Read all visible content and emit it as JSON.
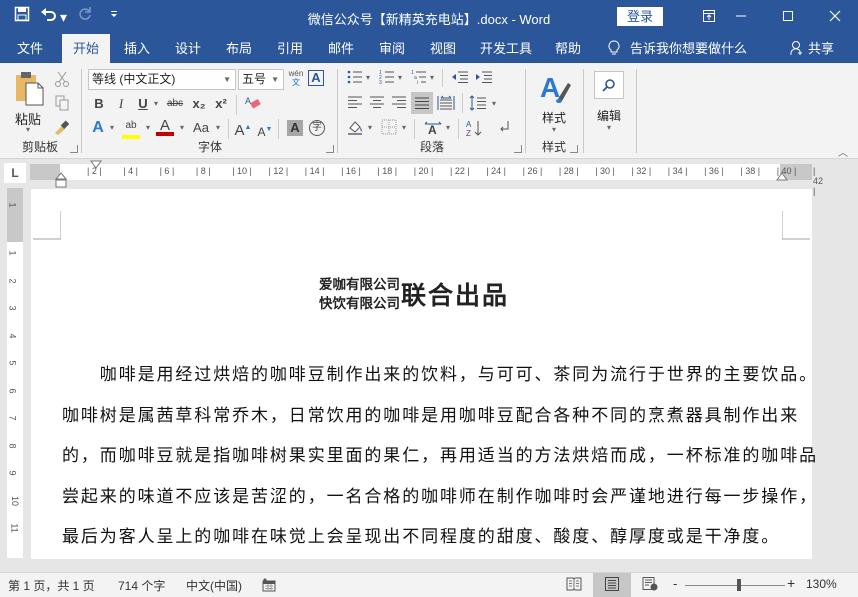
{
  "window": {
    "title": "微信公众号【新精英充电站】.docx  -  Word",
    "login_label": "登录",
    "controls": {
      "ribbon_display": "⊡",
      "minimize": "—",
      "maximize": "☐",
      "close": "✕"
    }
  },
  "qat": {
    "save_icon": "💾",
    "undo_icon": "↶",
    "undo_caret": "▾",
    "redo_icon": "↻",
    "customize_icon": "≡"
  },
  "tabs": [
    {
      "label": "文件"
    },
    {
      "label": "开始",
      "active": true
    },
    {
      "label": "插入"
    },
    {
      "label": "设计"
    },
    {
      "label": "布局"
    },
    {
      "label": "引用"
    },
    {
      "label": "邮件"
    },
    {
      "label": "审阅"
    },
    {
      "label": "视图"
    },
    {
      "label": "开发工具"
    },
    {
      "label": "帮助"
    }
  ],
  "tellme": {
    "icon": "💡",
    "label": "告诉我你想要做什么"
  },
  "share": {
    "icon": "👤",
    "label": "共享"
  },
  "ribbon": {
    "clipboard": {
      "label": "剪贴板",
      "paste_label": "粘贴"
    },
    "font": {
      "label": "字体",
      "font_name": "等线 (中文正文)",
      "font_size": "五号",
      "phonetic": "wén",
      "border_char": "A",
      "bold": "B",
      "italic": "I",
      "underline": "U",
      "strike": "abc",
      "subscript": "x₂",
      "superscript": "x²",
      "text_effect": "A",
      "highlight": "ab",
      "font_color": "A",
      "change_case": "Aa",
      "grow": "A",
      "shrink": "A",
      "shade": "A",
      "enclose": "字",
      "highlight_color": "#ffff00",
      "font_color_value": "#c00000"
    },
    "paragraph": {
      "label": "段落"
    },
    "styles": {
      "label": "样式",
      "button_label": "样式"
    },
    "editing": {
      "button_label": "编辑"
    }
  },
  "ruler": {
    "corner": "L",
    "h_numbers": [
      "2",
      "4",
      "6",
      "8",
      "10",
      "12",
      "14",
      "16",
      "18",
      "20",
      "22",
      "24",
      "26",
      "28",
      "30",
      "32",
      "34",
      "36",
      "38",
      "40",
      "42"
    ],
    "v_numbers": [
      "1",
      "1",
      "2",
      "3",
      "4",
      "5",
      "6",
      "7",
      "8",
      "9",
      "10",
      "11"
    ]
  },
  "document": {
    "title_combined": [
      "爱咖有限公司",
      "快饮有限公司"
    ],
    "title_main": "联合出品",
    "paragraph_lines": [
      "　　咖啡是用经过烘焙的咖啡豆制作出来的饮料，与可可、茶同为流行于世界的主要饮品。",
      "咖啡树是属茜草科常乔木，日常饮用的咖啡是用咖啡豆配合各种不同的烹煮器具制作出来",
      "的，而咖啡豆就是指咖啡树果实里面的果仁，再用适当的方法烘焙而成，一杯标准的咖啡品",
      "尝起来的味道不应该是苦涩的，一名合格的咖啡师在制作咖啡时会严谨地进行每一步操作，",
      "最后为客人呈上的咖啡在味觉上会呈现出不同程度的甜度、酸度、醇厚度或是干净度。"
    ]
  },
  "status": {
    "page": "第 1 页，共 1 页",
    "words": "714 个字",
    "language": "中文(中国)",
    "zoom_minus": "-",
    "zoom_plus": "+",
    "zoom_level": "130%",
    "zoom_percent": 130
  }
}
